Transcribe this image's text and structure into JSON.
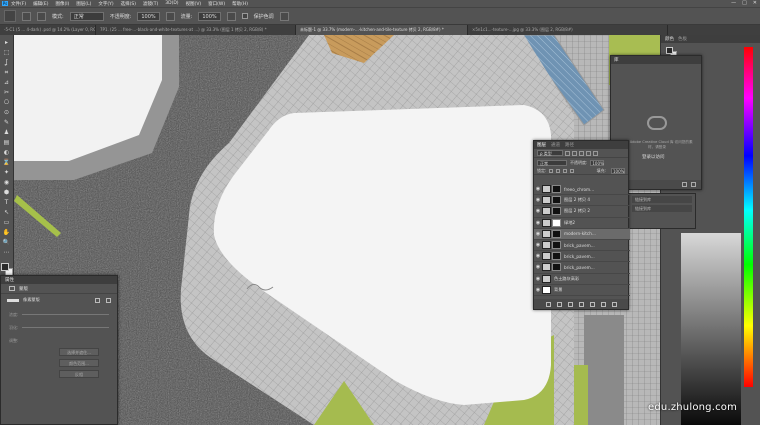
{
  "menu": {
    "app_logo": "Ps",
    "items": [
      "文件(F)",
      "编辑(E)",
      "图像(I)",
      "图层(L)",
      "文字(Y)",
      "选择(S)",
      "滤镜(T)",
      "3D(D)",
      "视图(V)",
      "窗口(W)",
      "帮助(H)"
    ]
  },
  "window": {
    "minimize": "—",
    "maximize": "□",
    "close": "✕"
  },
  "options": {
    "mode_label": "模式:",
    "mode_value": "正常",
    "opacity_label": "不透明度:",
    "opacity_value": "100%",
    "flow_label": "流量:",
    "flow_value": "100%",
    "protect_label": "保护色调"
  },
  "tabs": [
    {
      "label": "-5-C1 (5 ... 4-dark) .psd @ 14.2% (Layer 0, RGB/8)",
      "active": false
    },
    {
      "label": "7P1. (25 ... free-...-black-and-white-textures-at ...) @ 33.3% (图层 1 拷贝 2, RGB/8) *",
      "active": false
    },
    {
      "label": "未标题-1 @ 33.7% (modern-...-kitchen-and-tile-texture 拷贝 2, RGB/8#) *",
      "active": true
    },
    {
      "label": "×5n1c1...-texture-...jpg @ 33.3% (图层 2, RGB/8#)",
      "active": false
    }
  ],
  "tools": [
    "▸",
    "⬚",
    "ʆ",
    "⌗",
    "⊿",
    "✂",
    "⎔",
    "⊙",
    "✎",
    "♟",
    "▤",
    "◐",
    "⌛",
    "✦",
    "◉",
    "⬢",
    "T",
    "↖",
    "▭",
    "✋",
    "🔍",
    "⋯"
  ],
  "color_panel": {
    "tabs": [
      "颜色",
      "色板"
    ]
  },
  "libraries": {
    "tab": "库",
    "message": "使用 Adobe Creative Cloud 库 访问您的素材，请登录",
    "button": "登录以访问"
  },
  "adjust_panel": {
    "rows": [
      "链接到库",
      "链接到库"
    ]
  },
  "layers_panel": {
    "tabs": [
      "图层",
      "通道",
      "路径"
    ],
    "filter": "ρ 类型",
    "blend_mode": "正常",
    "opacity_label": "不透明度:",
    "opacity_value": "100%",
    "lock_label": "锁定:",
    "fill_label": "填充:",
    "fill_value": "100%",
    "layers": [
      {
        "name": "freeo_chrom...",
        "visible": true,
        "selected": false,
        "has_mask": true
      },
      {
        "name": "图层 2 拷贝 4",
        "visible": true,
        "selected": false,
        "has_mask": true
      },
      {
        "name": "图层 2 拷贝 2",
        "visible": true,
        "selected": false,
        "has_mask": true
      },
      {
        "name": "绿地2",
        "visible": true,
        "selected": false,
        "has_mask": true
      },
      {
        "name": "modern-kitch...",
        "visible": true,
        "selected": true,
        "has_mask": true
      },
      {
        "name": "brick_pavem...",
        "visible": true,
        "selected": false,
        "has_mask": true
      },
      {
        "name": "brick_pavem...",
        "visible": true,
        "selected": false,
        "has_mask": true
      },
      {
        "name": "brick_pavem...",
        "visible": true,
        "selected": false,
        "has_mask": true
      },
      {
        "name": "色土路灰高彩",
        "visible": true,
        "selected": false,
        "has_mask": false
      },
      {
        "name": "背景",
        "visible": true,
        "selected": false,
        "has_mask": false
      }
    ]
  },
  "properties": {
    "tab": "属性",
    "type": "蒙版",
    "mask_label": "像素蒙版",
    "density_label": "浓度:",
    "feather_label": "羽化:",
    "refine_label": "调整:",
    "buttons": [
      "选择并遮住...",
      "颜色范围...",
      "反相"
    ]
  },
  "watermark": "edu.zhulong.com"
}
